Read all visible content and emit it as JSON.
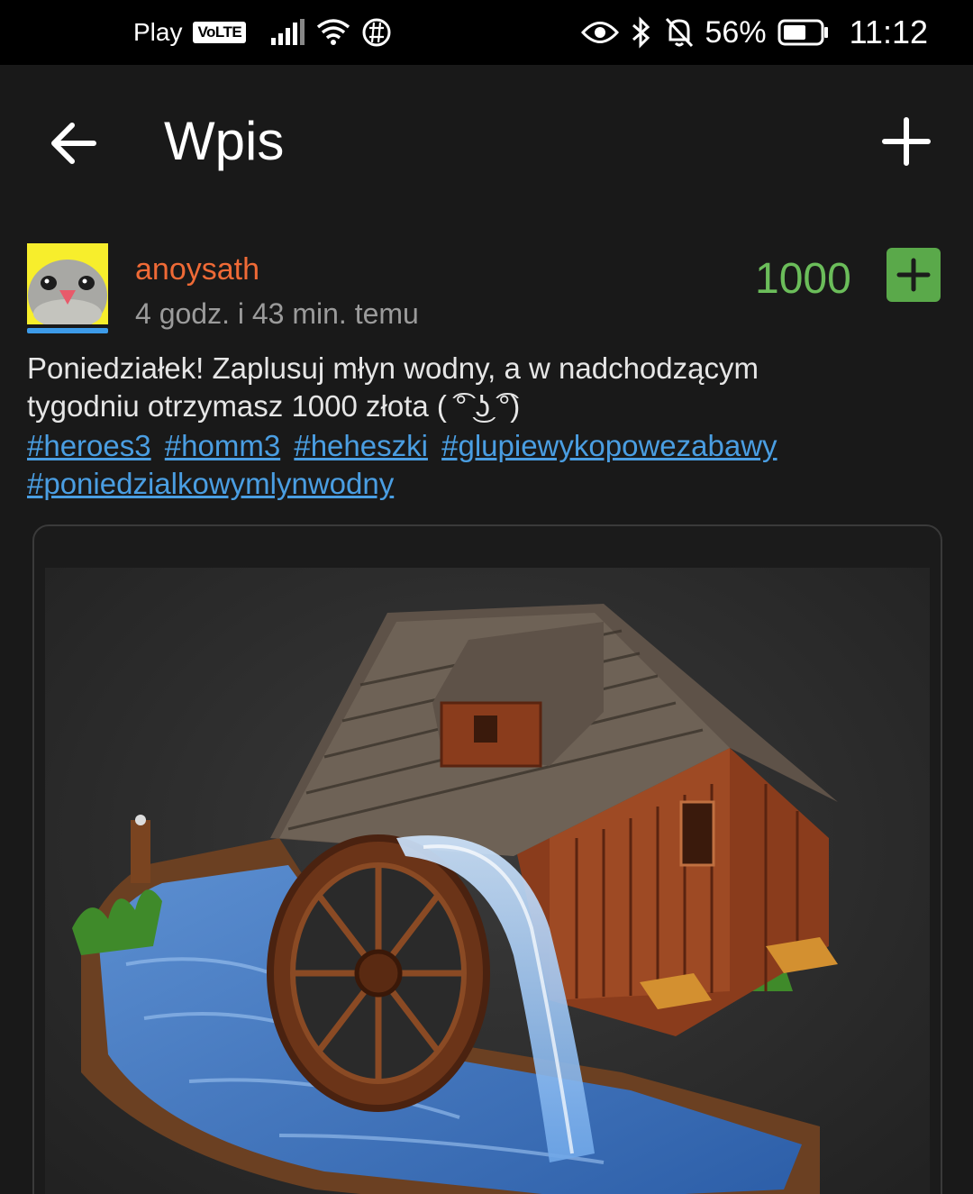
{
  "status_bar": {
    "carrier": "Play",
    "volte": "VoLTE",
    "battery_percent": "56%",
    "time": "11:12",
    "icons": [
      "signal-icon",
      "wifi-icon",
      "vpn-icon",
      "eye-icon",
      "bluetooth-icon",
      "mute-bell-icon",
      "battery-icon"
    ]
  },
  "app_bar": {
    "title": "Wpis",
    "back_icon": "arrow-left-icon",
    "add_icon": "plus-icon"
  },
  "post": {
    "author": "anoysath",
    "time_ago": "4 godz. i 43 min. temu",
    "votes": "1000",
    "vote_icon": "plus-icon",
    "body_line1": "Poniedziałek! Zaplusuj młyn wodny, a w nadchodzącym",
    "body_line2": "tygodniu otrzymasz 1000 złota ( ͡° ͜ʖ ͡°)",
    "tags": [
      "#heroes3",
      "#homm3",
      "#heheszki",
      "#glupiewykopowezabawy",
      "#poniedzialkowymlynwodny"
    ],
    "image_subject": "water-mill-image"
  },
  "colors": {
    "background": "#191919",
    "username": "#ef6a36",
    "votes": "#6bbd5a",
    "plus_button": "#5aa94a",
    "tag": "#4a9ee2",
    "avatar_bg": "#f7ee2c"
  }
}
